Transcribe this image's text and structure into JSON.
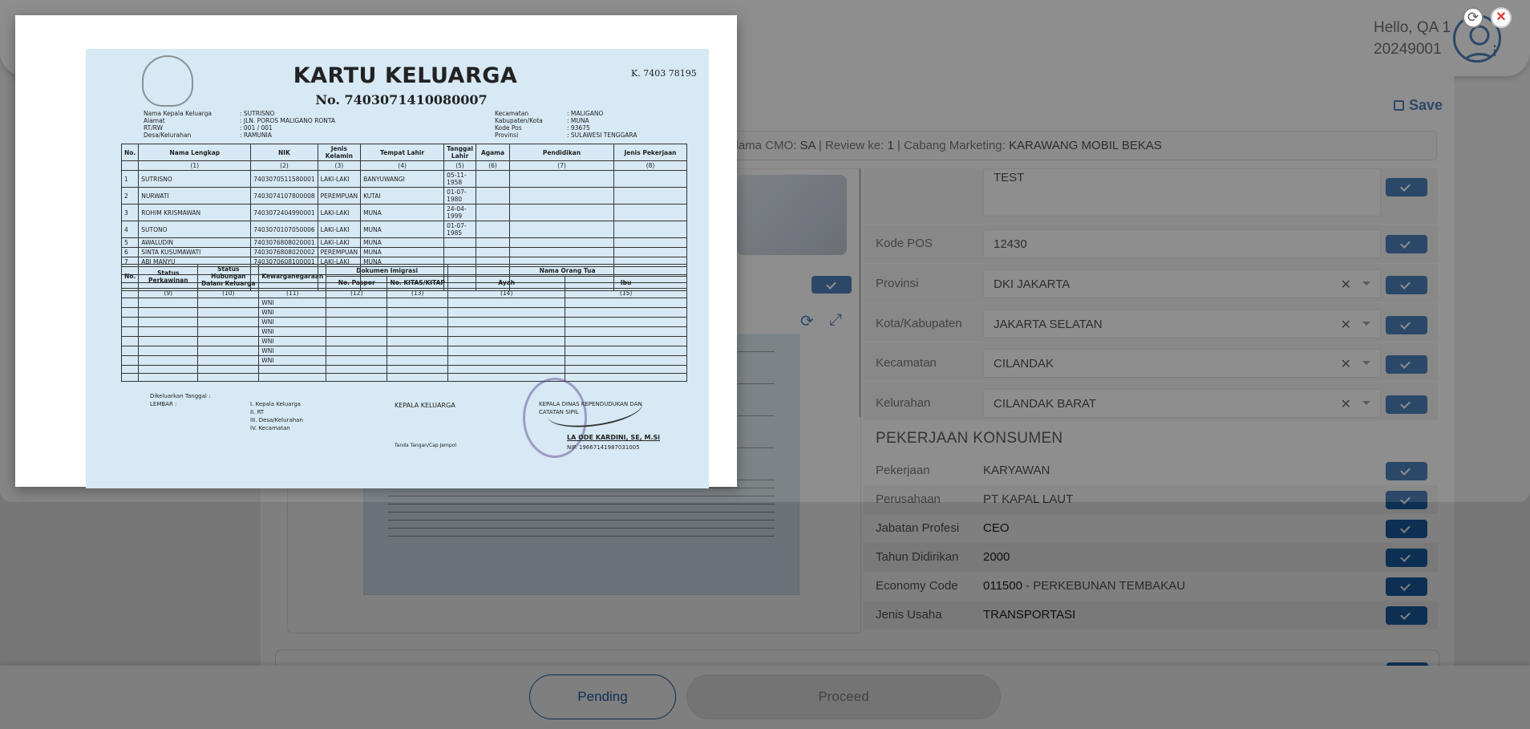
{
  "header": {
    "greeting": "Hello, QA 1",
    "user_id": "20249001"
  },
  "toolbar": {
    "save_label": "Save"
  },
  "infobar": {
    "cmo_label": "Nama CMO:",
    "cmo_value": "SA",
    "review_label": "Review ke:",
    "review_value": "1",
    "branch_label": "Cabang Marketing:",
    "branch_value": "KARAWANG MOBIL BEKAS"
  },
  "address": {
    "textarea_value": "TEST",
    "rows": [
      {
        "label": "Kode POS",
        "value": "12430"
      },
      {
        "label": "Provinsi",
        "value": "DKI JAKARTA"
      },
      {
        "label": "Kota/Kabupaten",
        "value": "JAKARTA SELATAN"
      },
      {
        "label": "Kecamatan",
        "value": "CILANDAK"
      },
      {
        "label": "Kelurahan",
        "value": "CILANDAK BARAT"
      }
    ]
  },
  "pekerjaan": {
    "section_title": "PEKERJAAN KONSUMEN",
    "rows": [
      {
        "label": "Pekerjaan",
        "value": "KARYAWAN",
        "sub": ""
      },
      {
        "label": "Perusahaan",
        "value": "PT KAPAL LAUT",
        "sub": ""
      },
      {
        "label": "Jabatan Profesi",
        "value": "CEO",
        "sub": ""
      },
      {
        "label": "Tahun Didirikan",
        "value": "2000",
        "sub": ""
      },
      {
        "label": "Economy Code",
        "value": "011500",
        "sub": " - PERKEBUNAN TEMBAKAU"
      },
      {
        "label": "Jenis Usaha",
        "value": "TRANSPORTASI",
        "sub": ""
      }
    ]
  },
  "footer": {
    "pending_label": "Pending",
    "proceed_label": "Proceed"
  },
  "modal": {
    "refresh_icon": "refresh-icon",
    "close_icon": "close-icon",
    "document": {
      "title": "KARTU KELUARGA",
      "number": "No. 7403071410080007",
      "serial": "K. 7403 78195",
      "left_meta": [
        {
          "label": "Nama Kepala Keluarga",
          "value": ": SUTRISNO"
        },
        {
          "label": "Alamat",
          "value": ": JLN. POROS MALIGANO RONTA"
        },
        {
          "label": "RT/RW",
          "value": ": 001 / 001"
        },
        {
          "label": "Desa/Kelurahan",
          "value": ": RAMUNIA"
        }
      ],
      "right_meta": [
        {
          "label": "Kecamatan",
          "value": ": MALIGANO"
        },
        {
          "label": "Kabupaten/Kota",
          "value": ": MUNA"
        },
        {
          "label": "Kode Pos",
          "value": ": 93675"
        },
        {
          "label": "Provinsi",
          "value": ": SULAWESI TENGGARA"
        }
      ],
      "table1_headers": [
        "No.",
        "Nama Lengkap",
        "NIK",
        "Jenis Kelamin",
        "Tempat Lahir",
        "Tanggal Lahir",
        "Agama",
        "Pendidikan",
        "Jenis Pekerjaan"
      ],
      "table1_codes": [
        "",
        "(1)",
        "(2)",
        "(3)",
        "(4)",
        "(5)",
        "(6)",
        "(7)",
        "(8)"
      ],
      "members": [
        {
          "no": "1",
          "name": "SUTRISNO",
          "nik": "7403070511580001",
          "sex": "LAKI-LAKI",
          "place": "BANYUWANGI",
          "dob": "05-11-1958"
        },
        {
          "no": "2",
          "name": "NURWATI",
          "nik": "7403074107800008",
          "sex": "PEREMPUAN",
          "place": "KUTAI",
          "dob": "01-07-1980"
        },
        {
          "no": "3",
          "name": "ROHIM KRISMAWAN",
          "nik": "7403072404990001",
          "sex": "LAKI-LAKI",
          "place": "MUNA",
          "dob": "24-04-1999"
        },
        {
          "no": "4",
          "name": "SUTONO",
          "nik": "7403070107050006",
          "sex": "LAKI-LAKI",
          "place": "MUNA",
          "dob": "01-07-1985"
        },
        {
          "no": "5",
          "name": "AWALUDIN",
          "nik": "7403076808020001",
          "sex": "LAKI-LAKI",
          "place": "MUNA",
          "dob": ""
        },
        {
          "no": "6",
          "name": "SINTA KUSUMAWATI",
          "nik": "7403076808020002",
          "sex": "PEREMPUAN",
          "place": "MUNA",
          "dob": ""
        },
        {
          "no": "7",
          "name": "ABI MANYU",
          "nik": "7403070608100001",
          "sex": "LAKI-LAKI",
          "place": "MUNA",
          "dob": ""
        }
      ],
      "table2_headers": [
        "No.",
        "Status Perkawinan",
        "Status Hubungan Dalam Keluarga",
        "Kewarganegaraan",
        "No. Paspor",
        "No. KITAS/KITAP",
        "Ayah",
        "Ibu"
      ],
      "table2_group_headers": [
        "Dokumen Imigrasi",
        "Nama Orang Tua"
      ],
      "table2_codes": [
        "",
        "(9)",
        "(10)",
        "(11)",
        "(12)",
        "(13)",
        "(14)",
        "(15)"
      ],
      "table2_citizenship": "WNI",
      "footnote_left": [
        "Dikeluarkan Tanggal :",
        "LEMBAR :"
      ],
      "footnote_list": [
        "I. Kepala Keluarga",
        "II. RT",
        "III. Desa/Kelurahan",
        "IV. Kecamatan"
      ],
      "kepala_label": "KEPALA KELUARGA",
      "ttd_label": "Tanda Tangan/Cap Jempol",
      "office": "KEPALA DINAS KEPENDUDUKAN DAN CATATAN SIPIL",
      "official_name": "LA ODE KARDINI, SE, M.Si",
      "official_nip": "NIP. 19667141987031005"
    }
  }
}
